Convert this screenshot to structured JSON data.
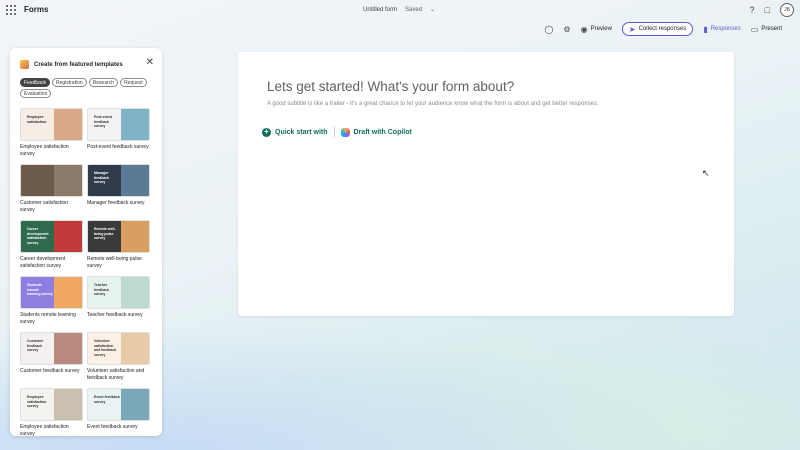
{
  "app": {
    "name": "Forms"
  },
  "document": {
    "title": "Untitled form",
    "status": "Saved"
  },
  "user": {
    "initials": "JB"
  },
  "toolbar": {
    "preview": "Preview",
    "collect": "Collect responses",
    "responses": "Responses",
    "present": "Present"
  },
  "panel": {
    "title": "Create from featured templates",
    "chips": [
      "Feedback",
      "Registration",
      "Research",
      "Request",
      "Evaluation"
    ],
    "templates": [
      {
        "name": "Employee satisfaction survey",
        "thumb_text": "Employee satisfaction",
        "bg": "#f6ede4",
        "art": "#d9a98a"
      },
      {
        "name": "Post-event feedback survey",
        "thumb_text": "Post-event feedback survey",
        "bg": "#f1f3f5",
        "art": "#7fb3c8"
      },
      {
        "name": "Customer satisfaction survey",
        "thumb_text": "",
        "bg": "#6b5b4b",
        "art": "#8c7a68"
      },
      {
        "name": "Manager feedback survey",
        "thumb_text": "Manager feedback survey",
        "bg": "#2f3b4a",
        "art": "#5b7a94"
      },
      {
        "name": "Career development satisfaction survey",
        "thumb_text": "Career development satisfaction survey",
        "bg": "#2e6b4e",
        "art": "#c23b3b"
      },
      {
        "name": "Remote well-being pulse survey",
        "thumb_text": "Remote well-being pulse survey",
        "bg": "#3a3a3a",
        "art": "#d8a060"
      },
      {
        "name": "Students remote learning survey",
        "thumb_text": "Students remote learning survey",
        "bg": "#8e7ee0",
        "art": "#f0a860"
      },
      {
        "name": "Teacher feedback survey",
        "thumb_text": "Teacher feedback survey",
        "bg": "#e6f2ef",
        "art": "#bcd9d2"
      },
      {
        "name": "Customer feedback survey",
        "thumb_text": "Customer feedback survey",
        "bg": "#f3f0ef",
        "art": "#b88a80"
      },
      {
        "name": "Volunteer satisfaction and feedback survey",
        "thumb_text": "Volunteer satisfaction and feedback survey",
        "bg": "#faf0e6",
        "art": "#e8c9a8"
      },
      {
        "name": "Employee satisfaction survey",
        "thumb_text": "Employee satisfaction survey",
        "bg": "#f5f3ef",
        "art": "#c9c0b0"
      },
      {
        "name": "Event feedback survey",
        "thumb_text": "Event feedback survey",
        "bg": "#e9f3f3",
        "art": "#7aa8b8"
      }
    ]
  },
  "main": {
    "title": "Lets get started! What's your form about?",
    "subtitle": "A good subtitle is like a trailer - it's a great chance to let your audience know what the form is about and get better responses.",
    "quick_start": "Quick start with",
    "copilot": "Draft with Copilot"
  }
}
